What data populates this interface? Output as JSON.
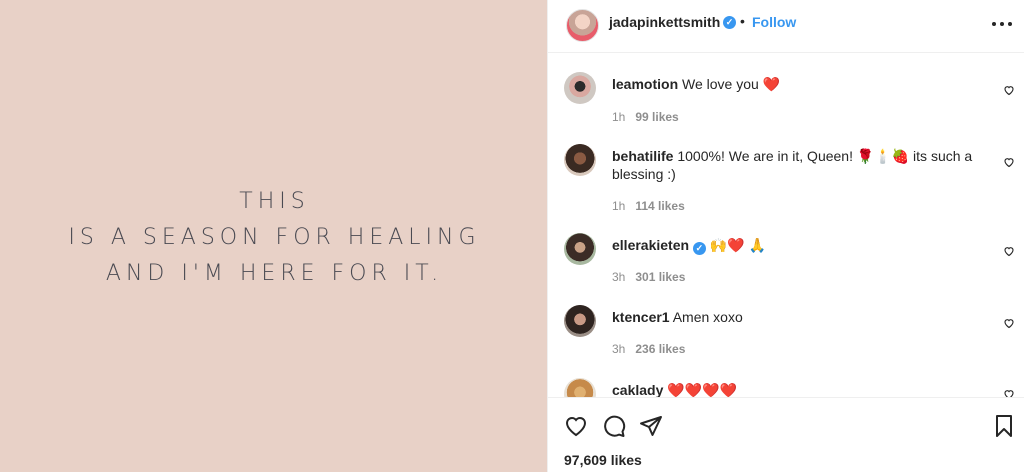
{
  "post": {
    "quote_lines": [
      "THIS",
      "IS A SEASON FOR HEALING",
      "AND I'M HERE FOR IT."
    ]
  },
  "header": {
    "username": "jadapinkettsmith",
    "separator": "•",
    "follow_label": "Follow"
  },
  "comments": [
    {
      "user": "leamotion",
      "verified": false,
      "text": " We love you ❤️",
      "time": "1h",
      "likes": "99 likes"
    },
    {
      "user": "behatilife",
      "verified": false,
      "text": " 1000%! We are in it, Queen! 🌹🕯️🍓 its such a blessing :)",
      "time": "1h",
      "likes": "114 likes"
    },
    {
      "user": "ellerakieten",
      "verified": true,
      "text": " 🙌❤️ 🙏",
      "time": "3h",
      "likes": "301 likes"
    },
    {
      "user": "ktencer1",
      "verified": false,
      "text": " Amen xoxo",
      "time": "3h",
      "likes": "236 likes"
    },
    {
      "user": "caklady",
      "verified": false,
      "text": " ❤️❤️❤️❤️",
      "time": "",
      "likes": ""
    }
  ],
  "actions": {
    "like_icon": "heart-icon",
    "comment_icon": "comment-icon",
    "share_icon": "paper-plane-icon",
    "save_icon": "bookmark-icon",
    "likes_count": "97,609 likes"
  },
  "colors": {
    "post_background": "#e8d1c7",
    "quote_text": "#4a4a52",
    "link_blue": "#3897f0",
    "muted": "#8e8e8e"
  }
}
